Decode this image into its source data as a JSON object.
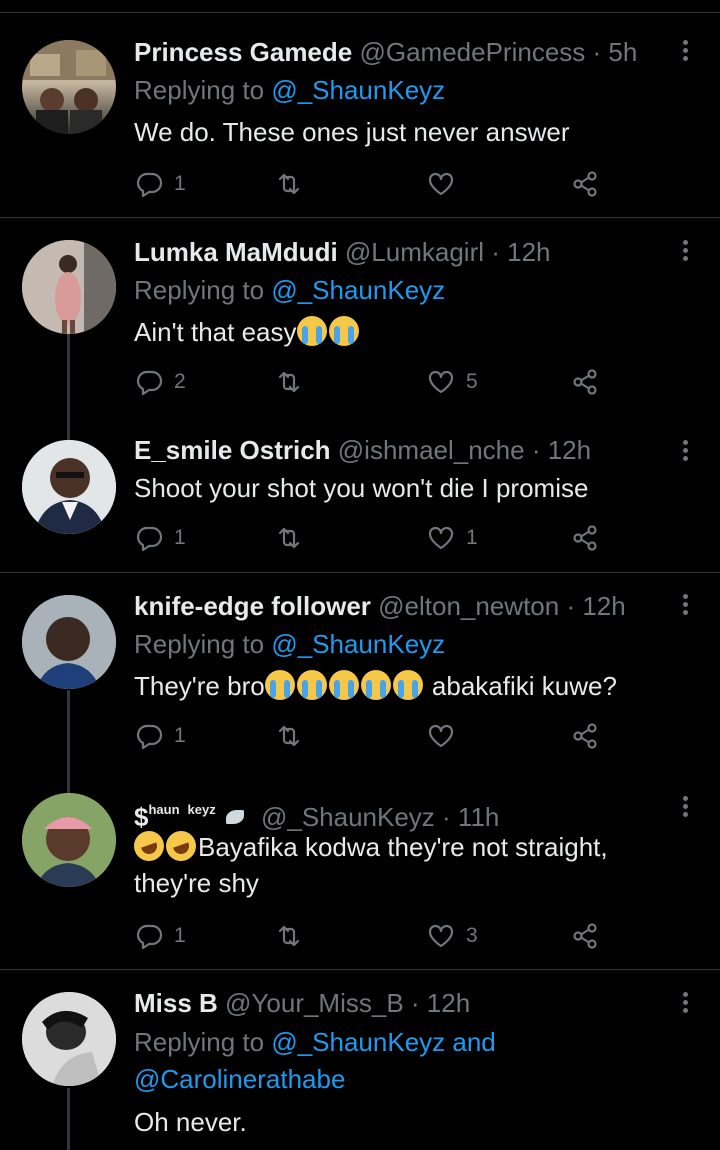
{
  "tweets": [
    {
      "name": "Princess Gamede",
      "handle": "@GamedePrincess",
      "time": "· 5h",
      "replying_prefix": "Replying to",
      "replying_to": "@_ShaunKeyz",
      "text": "We do. These ones just never answer",
      "replies": "1",
      "retweets": "",
      "likes": "",
      "avatar_colors": [
        "#3c4a3a",
        "#6b5a48"
      ]
    },
    {
      "name": "Lumka MaMdudi",
      "handle": "@Lumkagirl",
      "time": "· 12h",
      "replying_prefix": "Replying to",
      "replying_to": "@_ShaunKeyz",
      "text": "Ain't that easy",
      "replies": "2",
      "retweets": "",
      "likes": "5",
      "avatar_colors": [
        "#c9b3a8",
        "#8a6f6a"
      ]
    },
    {
      "name": "E_smile Ostrich",
      "handle": "@ishmael_nche",
      "time": "· 12h",
      "text": "Shoot your shot you won't die I promise",
      "replies": "1",
      "retweets": "",
      "likes": "1",
      "avatar_colors": [
        "#e9ecef",
        "#4a3a30"
      ]
    },
    {
      "name": "knife-edge follower",
      "handle": "@elton_newton",
      "time": "· 12h",
      "replying_prefix": "Replying to",
      "replying_to": "@_ShaunKeyz",
      "text_start": "They're bro",
      "text_end": " abakafiki kuwe?",
      "replies": "1",
      "retweets": "",
      "likes": "",
      "avatar_colors": [
        "#9aa3ab",
        "#3b2a22"
      ]
    },
    {
      "name_main": "$",
      "name_sup": "haun",
      "name_sup2": "keyz",
      "name_sub": "_",
      "handle": "@_ShaunKeyz",
      "time": "· 11h",
      "text_line1": "Bayafika kodwa they're not straight,",
      "text_line2": "they're shy",
      "replies": "1",
      "retweets": "",
      "likes": "3",
      "avatar_colors": [
        "#8fa86a",
        "#5a3a2a"
      ]
    },
    {
      "name": "Miss B",
      "handle": "@Your_Miss_B",
      "time": "· 12h",
      "replying_prefix": "Replying to",
      "replying_to": "@_ShaunKeyz and",
      "replying_to2": "@Carolinerathabe",
      "text": "Oh never.",
      "avatar_colors": [
        "#d9d9d9",
        "#2a2a2a"
      ]
    }
  ],
  "icons": {
    "reply": "reply-icon",
    "retweet": "retweet-icon",
    "like": "heart-icon",
    "share": "share-icon",
    "more": "more-icon"
  },
  "colors": {
    "background": "#000000",
    "text": "#e7e9ea",
    "muted": "#71767b",
    "link": "#1d9bf0",
    "divider": "#2f3336"
  }
}
